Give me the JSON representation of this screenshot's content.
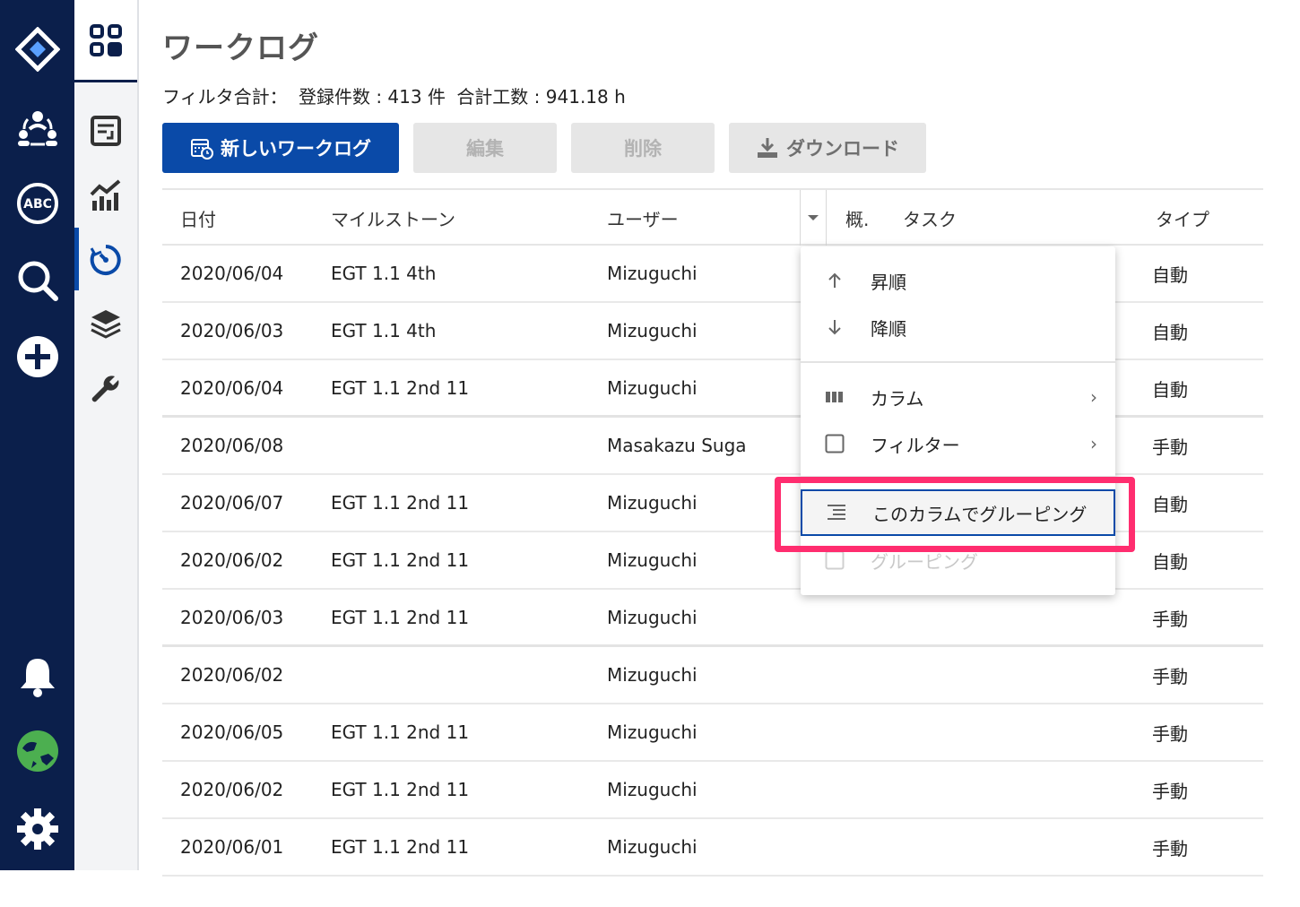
{
  "page": {
    "title": "ワークログ",
    "summary": {
      "label": "フィルタ合計：",
      "count": "登録件数 : 413 件",
      "total": "合計工数 : 941.18 h"
    }
  },
  "toolbar": {
    "new_label": "新しいワークログ",
    "edit_label": "編集",
    "delete_label": "削除",
    "download_label": "ダウンロード"
  },
  "table": {
    "headers": {
      "date": "日付",
      "milestone": "マイルストーン",
      "user": "ユーザー",
      "summary": "概.",
      "task": "タスク",
      "type": "タイプ"
    },
    "rows": [
      {
        "date": "2020/06/04",
        "milestone": "EGT 1.1 4th",
        "user": "Mizuguchi",
        "type": "自動"
      },
      {
        "date": "2020/06/03",
        "milestone": "EGT 1.1 4th",
        "user": "Mizuguchi",
        "type": "自動"
      },
      {
        "date": "2020/06/04",
        "milestone": "EGT 1.1 2nd 11",
        "user": "Mizuguchi",
        "type": "自動"
      },
      {
        "date": "2020/06/08",
        "milestone": "",
        "user": "Masakazu Suga",
        "type": "手動"
      },
      {
        "date": "2020/06/07",
        "milestone": "EGT 1.1 2nd 11",
        "user": "Mizuguchi",
        "type": "自動"
      },
      {
        "date": "2020/06/02",
        "milestone": "EGT 1.1 2nd 11",
        "user": "Mizuguchi",
        "type": "自動"
      },
      {
        "date": "2020/06/03",
        "milestone": "EGT 1.1 2nd 11",
        "user": "Mizuguchi",
        "type": "手動"
      },
      {
        "date": "2020/06/02",
        "milestone": "",
        "user": "Mizuguchi",
        "type": "手動"
      },
      {
        "date": "2020/06/05",
        "milestone": "EGT 1.1 2nd 11",
        "user": "Mizuguchi",
        "type": "手動"
      },
      {
        "date": "2020/06/02",
        "milestone": "EGT 1.1 2nd 11",
        "user": "Mizuguchi",
        "type": "手動"
      },
      {
        "date": "2020/06/01",
        "milestone": "EGT 1.1 2nd 11",
        "user": "Mizuguchi",
        "type": "手動"
      }
    ]
  },
  "column_menu": {
    "asc": "昇順",
    "desc": "降順",
    "columns": "カラム",
    "filter": "フィルター",
    "group_by": "このカラムでグルーピング",
    "grouping": "グルーピング"
  },
  "colors": {
    "nav": "#0b1f4b",
    "primary": "#0a4aa8",
    "highlight": "#ff2d6f",
    "globe": "#4caf50"
  }
}
